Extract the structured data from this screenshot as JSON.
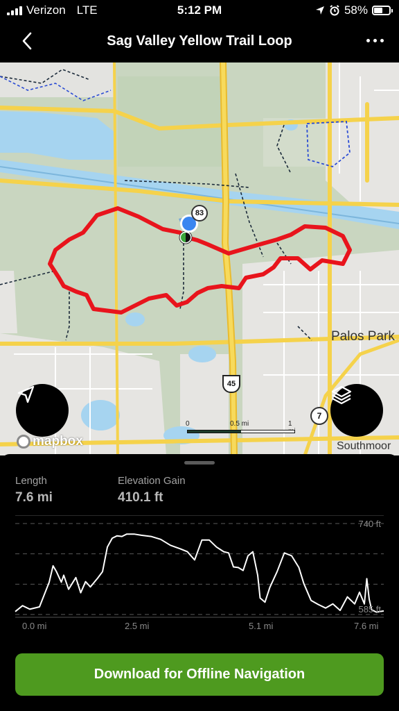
{
  "status_bar": {
    "carrier": "Verizon",
    "network": "LTE",
    "time": "5:12 PM",
    "battery": "58%",
    "battery_level": 0.58
  },
  "nav": {
    "title": "Sag Valley Yellow Trail Loop",
    "back_icon": "chevron-left-icon",
    "more_icon": "more-icon"
  },
  "map": {
    "labels": {
      "palos_park": "Palos Park",
      "southmoor": "Southmoor"
    },
    "route_shields": {
      "us_45": "45",
      "route_83": "83",
      "route_7": "7"
    },
    "scale": {
      "zero": "0",
      "half": "0.5 mi",
      "one": "1 mi"
    },
    "attribution": "mapbox",
    "colors": {
      "trail": "#e8141c",
      "current_location": "#3a86f0"
    }
  },
  "stats": {
    "length_label": "Length",
    "length_value": "7.6 mi",
    "elevation_label": "Elevation Gain",
    "elevation_value": "410.1 ft"
  },
  "chart_data": {
    "type": "line",
    "title": "",
    "xlabel": "",
    "ylabel": "",
    "x_ticks": [
      "0.0 mi",
      "2.5 mi",
      "5.1 mi",
      "7.6 mi"
    ],
    "y_ticks": [
      "740 ft",
      "585 ft"
    ],
    "xlim": [
      0,
      7.6
    ],
    "ylim": [
      585,
      740
    ],
    "grid": true,
    "series": [
      {
        "x": [
          0.0,
          0.15,
          0.3,
          0.5,
          0.7,
          0.78,
          0.85,
          0.95,
          1.0,
          1.1,
          1.25,
          1.35,
          1.45,
          1.55,
          1.7,
          1.8,
          1.9,
          2.0,
          2.1,
          2.2,
          2.3,
          2.45,
          2.6,
          2.8,
          3.0,
          3.2,
          3.4,
          3.55,
          3.7,
          3.85,
          4.0,
          4.15,
          4.3,
          4.4,
          4.5,
          4.6,
          4.7,
          4.8,
          4.9,
          5.0,
          5.05,
          5.15,
          5.25,
          5.4,
          5.55,
          5.7,
          5.85,
          5.95,
          6.1,
          6.25,
          6.4,
          6.55,
          6.7,
          6.85,
          7.0,
          7.1,
          7.2,
          7.25,
          7.3,
          7.35,
          7.45,
          7.6
        ],
        "y": [
          590,
          600,
          594,
          598,
          640,
          668,
          658,
          640,
          652,
          628,
          648,
          622,
          641,
          632,
          647,
          658,
          700,
          715,
          719,
          718,
          722,
          722,
          720,
          718,
          713,
          703,
          697,
          692,
          678,
          712,
          712,
          700,
          692,
          690,
          666,
          665,
          660,
          685,
          692,
          652,
          613,
          606,
          631,
          658,
          690,
          685,
          665,
          638,
          609,
          602,
          596,
          603,
          592,
          615,
          603,
          623,
          603,
          646,
          611,
          593,
          589,
          591
        ]
      }
    ]
  },
  "download": {
    "label": "Download for Offline Navigation",
    "color": "#4e9a1f"
  }
}
